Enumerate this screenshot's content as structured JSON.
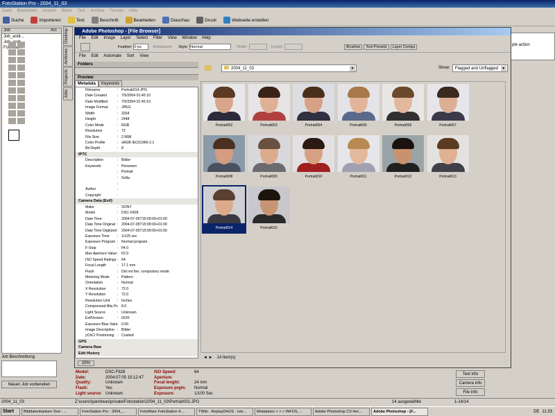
{
  "app": {
    "title": "FotoStation Pro - 2004_11_03",
    "menu": [
      "Datei",
      "Bearbeiten",
      "Ansicht",
      "Bilder",
      "Text",
      "Archive",
      "Fenster",
      "Hilfe"
    ],
    "toolbar": [
      "Suche",
      "Importeren",
      "Text",
      "Beschnitt",
      "Bearbeiten",
      "Diaschau",
      "Druck",
      "Webseite erstellen"
    ]
  },
  "left": {
    "cols": [
      "Job",
      "Arc"
    ],
    "jobs": [
      "Job_andr...",
      "Job_andr...",
      "Fotostati..."
    ],
    "tab_label": "ubl.",
    "job_label": "Job Beschreibung",
    "new_job": "Neuen Job vorbereiten"
  },
  "side_tabs": [
    "Desktop",
    "Archives",
    "Projects",
    "Jobs"
  ],
  "photoshop": {
    "title": "Adobe Photoshop - [File Browser]",
    "menu": [
      "File",
      "Edit",
      "Image",
      "Layer",
      "Select",
      "Filter",
      "View",
      "Window",
      "Help"
    ],
    "options": {
      "feather_label": "Feather:",
      "feather_value": "0 px",
      "antialiased": "Antialiased",
      "style_label": "Style:",
      "style_value": "Normal",
      "width_label": "Width:",
      "height_label": "Height:"
    },
    "palette_tabs": [
      "Brushes",
      "Tool Presets",
      "Layer Comps"
    ],
    "fb_menu": [
      "File",
      "Edit",
      "Automate",
      "Sort",
      "View"
    ],
    "folders_label": "Folders",
    "preview_label": "Preview",
    "meta_tabs": [
      "Metadata",
      "Keywords"
    ],
    "folder": "2004_11_03",
    "show_label": "Show:",
    "show_value": "Flagged and Unflagged",
    "zoom": "25%",
    "items_count": "14 Item(s)"
  },
  "metadata": [
    {
      "k": "Filename",
      "v": "Portrait014.JPG"
    },
    {
      "k": "Date Created",
      "v": "7/5/2004 01:45:10"
    },
    {
      "k": "Date Modified",
      "v": "7/5/2004 01:45:10"
    },
    {
      "k": "Image Format",
      "v": "JPEG"
    },
    {
      "k": "Width",
      "v": "3264"
    },
    {
      "k": "Height",
      "v": "2448"
    },
    {
      "k": "Color Mode",
      "v": "RGB"
    },
    {
      "k": "Resolution",
      "v": "72"
    },
    {
      "k": "File Size",
      "v": "2.96M"
    },
    {
      "k": "Color Profile",
      "v": "sRGB IEC61966-2.1"
    },
    {
      "k": "Bit Depth",
      "v": "8"
    },
    {
      "sec": "IPTC"
    },
    {
      "k": "Description",
      "v": "Bilder"
    },
    {
      "k": "Keywords",
      "v": "Personen"
    },
    {
      "k": "",
      "v": "Portrait"
    },
    {
      "k": "",
      "v": "Sofia"
    },
    {
      "k": "",
      "v": ""
    },
    {
      "k": "Author",
      "v": ""
    },
    {
      "k": "Copyright",
      "v": ""
    },
    {
      "sec": "Camera Data (Exif)"
    },
    {
      "k": "Make",
      "v": "SONY"
    },
    {
      "k": "Model",
      "v": "DSC-F828"
    },
    {
      "k": "Date Time",
      "v": "2004-07-05T15:09:00+01:00"
    },
    {
      "k": "Date Time Original",
      "v": "2004-07-05T15:09:00+01:00"
    },
    {
      "k": "Date Time Digitized",
      "v": "2004-07-05T15:09:00+01:00"
    },
    {
      "k": "Exposure Time",
      "v": "1/125 sec"
    },
    {
      "k": "Exposure Program",
      "v": "Normal program"
    },
    {
      "k": "F-Stop",
      "v": "f/4.0"
    },
    {
      "k": "Max Aperture Value",
      "v": "f/2.0"
    },
    {
      "k": "ISO Speed Ratings",
      "v": "64"
    },
    {
      "k": "Focal Length",
      "v": "17.1 mm"
    },
    {
      "k": "Flash",
      "v": "Did not fire, compulsory mode"
    },
    {
      "k": "Metering Mode",
      "v": "Pattern"
    },
    {
      "k": "Orientation",
      "v": "Normal"
    },
    {
      "k": "X Resolution",
      "v": "72.0"
    },
    {
      "k": "Y Resolution",
      "v": "72.0"
    },
    {
      "k": "Resolution Unit",
      "v": "Inches"
    },
    {
      "k": "Compressed Bits Per Pixel",
      "v": "8.0"
    },
    {
      "k": "Light Source",
      "v": "Unknown"
    },
    {
      "k": "ExifVersion",
      "v": "0220"
    },
    {
      "k": "Exposure Bias Value",
      "v": "0.00"
    },
    {
      "k": "Image Description",
      "v": "Bilder"
    },
    {
      "k": "yCbCr Positioning",
      "v": "Cosited"
    },
    {
      "sec": "GPS"
    },
    {
      "sec": "Camera Raw"
    },
    {
      "sec": "Edit History"
    }
  ],
  "thumbs": [
    {
      "name": "Portrait002",
      "skin": "#d9a58a",
      "hair": "#5a3a22",
      "shirt": "#2a2a3a",
      "bg": "#e8e8ea"
    },
    {
      "name": "Portrait003",
      "skin": "#e0b096",
      "hair": "#3a2418",
      "shirt": "#b04040",
      "bg": "#e6e4e4"
    },
    {
      "name": "Portrait004",
      "skin": "#d7a184",
      "hair": "#4a2e1c",
      "shirt": "#303040",
      "bg": "#dcdde2"
    },
    {
      "name": "Portrait005",
      "skin": "#e2b59a",
      "hair": "#a8784a",
      "shirt": "#5a6a8a",
      "bg": "#e4e4e8"
    },
    {
      "name": "Portrait006",
      "skin": "#e3b69e",
      "hair": "#6a4a2a",
      "shirt": "#303030",
      "bg": "#e8e6e4"
    },
    {
      "name": "Portrait007",
      "skin": "#dcae94",
      "hair": "#3c2a1e",
      "shirt": "#3a3a4a",
      "bg": "#e6e6ea"
    },
    {
      "name": "Portrait008",
      "skin": "#d49c80",
      "hair": "#4a3020",
      "shirt": "#4a5060",
      "bg": "#8a9aa8"
    },
    {
      "name": "Portrait009",
      "skin": "#dcaa8c",
      "hair": "#6a5040",
      "shirt": "#6a6a70",
      "bg": "#d8d8dc"
    },
    {
      "name": "Portrait010",
      "skin": "#d8a082",
      "hair": "#2a1a12",
      "shirt": "#a02020",
      "bg": "#e2e0e2"
    },
    {
      "name": "Portrait011",
      "skin": "#e4b89c",
      "hair": "#b88a52",
      "shirt": "#a0a0b0",
      "bg": "#e6e6ea"
    },
    {
      "name": "Portrait012",
      "skin": "#c8926e",
      "hair": "#1a120c",
      "shirt": "#202020",
      "bg": "#9aa4a8"
    },
    {
      "name": "Portrait013",
      "skin": "#e0b092",
      "hair": "#5a3a22",
      "shirt": "#404048",
      "bg": "#e4e2e0"
    },
    {
      "name": "Portrait014",
      "skin": "#dcaa8a",
      "hair": "#5a4030",
      "shirt": "#3a3a40",
      "bg": "#d0d0d4"
    },
    {
      "name": "Portrait015",
      "skin": "#c89474",
      "hair": "#1e140e",
      "shirt": "#2a2a2a",
      "bg": "#c8c8cc"
    }
  ],
  "info": [
    {
      "k": "Model:",
      "v": "DSC-F828",
      "k2": "ISO Speed:",
      "v2": "64"
    },
    {
      "k": "Date:",
      "v": "2004:07:05 15:12:47",
      "k2": "Aperture:",
      "v2": ""
    },
    {
      "k": "Quality:",
      "v": "Unknown",
      "k2": "Focal lenght:",
      "v2": "24 mm"
    },
    {
      "k": "Flash:",
      "v": "Yes",
      "k2": "Exposure prgm:",
      "v2": "Normal"
    },
    {
      "k": "Light source:",
      "v": "Unknown",
      "k2": "Exposure:",
      "v2": "1/100 Sec"
    }
  ],
  "info_buttons": [
    "Text info",
    "Camera info",
    "File info"
  ],
  "right_panel": {
    "action": "ple action"
  },
  "status": {
    "folder": "2004_11_03",
    "path": "Z:\\users\\lyandreas\\private\\Fotostation\\2004_11_03\\Portrait002.JPG",
    "selected": "14 ausgewählte",
    "range": "1-14/14"
  },
  "taskbar": {
    "start": "Start",
    "tasks": [
      "Bilddatenbanken-Test - ...",
      "FotoStation Pro - 2004_...",
      "FotoWare FotoStation 4....",
      "TWiki . ReplayDHOS . Ivie...",
      "Metadaten > > > INFOS, ...",
      "Adobe Photoshop CS Hel...",
      "Adobe Photoshop - [F..."
    ],
    "lang": "DE",
    "clock": "11:33"
  }
}
